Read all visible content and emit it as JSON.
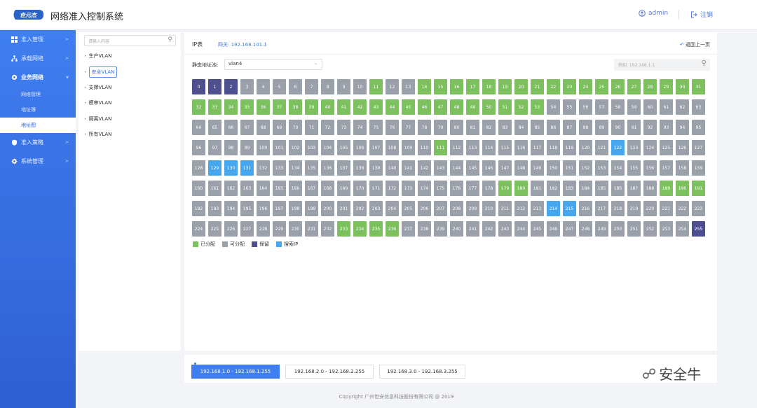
{
  "app": {
    "logo_text": "世元杰",
    "title": "网络准入控制系统"
  },
  "header": {
    "user": "admin",
    "logout": "注销"
  },
  "sidebar": {
    "items": [
      {
        "label": "准入管理",
        "icon": "grid-icon"
      },
      {
        "label": "承载网络",
        "icon": "network-icon"
      },
      {
        "label": "业务网络",
        "icon": "gear-icon",
        "open": true
      },
      {
        "label": "准入策略",
        "icon": "shield-icon"
      },
      {
        "label": "系统管理",
        "icon": "settings-icon"
      }
    ],
    "sub_items": [
      {
        "label": "网络管理"
      },
      {
        "label": "地址簿"
      },
      {
        "label": "地址图",
        "active": true
      }
    ]
  },
  "tree": {
    "placeholder": "请输入内容",
    "nodes": [
      "生产VLAN",
      "安全VLAN",
      "支撑VLAN",
      "模审VLAN",
      "隔离VLAN",
      "所有VLAN"
    ],
    "selected": "安全VLAN"
  },
  "panel": {
    "title": "IP表",
    "gateway": "网关: 192.168.101.1",
    "back": "返回上一页",
    "pool_label": "静态地址池:",
    "pool_value": "vlan4",
    "search_placeholder": "例如: 192.168.1.1"
  },
  "ip_grid": {
    "total": 256,
    "reserved": [
      0,
      1,
      2,
      255
    ],
    "assigned": [
      11,
      14,
      15,
      16,
      17,
      18,
      19,
      20,
      21,
      22,
      23,
      24,
      25,
      26,
      27,
      28,
      29,
      30,
      31,
      32,
      33,
      34,
      35,
      36,
      37,
      38,
      39,
      40,
      41,
      42,
      43,
      44,
      45,
      46,
      47,
      48,
      49,
      50,
      51,
      52,
      53,
      111,
      179,
      180,
      189,
      190,
      191,
      233,
      234,
      235,
      236
    ],
    "searched": [
      122,
      129,
      130,
      131,
      214,
      215
    ],
    "colors": {
      "assigned": "#7dc15e",
      "available": "#9aa1ab",
      "reserved": "#4e4f8f",
      "searched": "#46a7ef"
    }
  },
  "legend": [
    {
      "label": "已分配",
      "color": "#7dc15e"
    },
    {
      "label": "可分配",
      "color": "#9aa1ab"
    },
    {
      "label": "保留",
      "color": "#4e4f8f"
    },
    {
      "label": "搜索IP",
      "color": "#46a7ef"
    }
  ],
  "ranges": [
    {
      "label": "192.168.1.0 - 192.168.1.255",
      "active": true
    },
    {
      "label": "192.168.2.0 - 192.168.2.255"
    },
    {
      "label": "192.168.3.0 - 192.168.3.255"
    }
  ],
  "footer": {
    "copyright": "Copyright  广州世安信息科技股份有限公司 @ 2019"
  },
  "watermark": {
    "text": "安全牛"
  }
}
